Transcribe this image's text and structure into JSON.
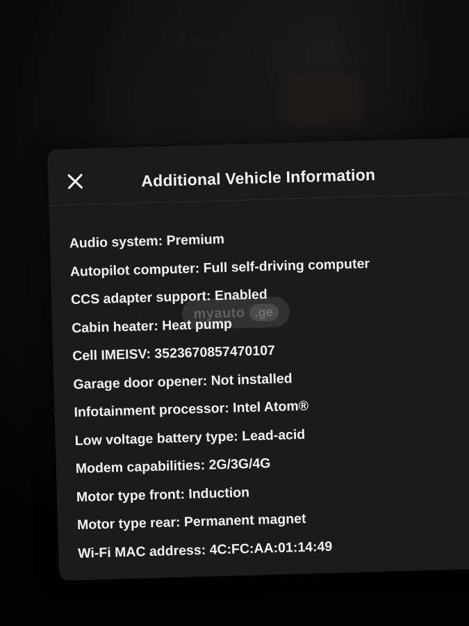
{
  "background": {
    "blurred_text": "Easy Entry"
  },
  "dialog": {
    "title": "Additional Vehicle Information",
    "close_icon": "close-icon",
    "rows": [
      {
        "label": "Audio system",
        "value": "Premium"
      },
      {
        "label": "Autopilot computer",
        "value": "Full self-driving computer"
      },
      {
        "label": "CCS adapter support",
        "value": "Enabled"
      },
      {
        "label": "Cabin heater",
        "value": "Heat pump"
      },
      {
        "label": "Cell IMEISV",
        "value": "3523670857470107"
      },
      {
        "label": "Garage door opener",
        "value": "Not installed"
      },
      {
        "label": "Infotainment processor",
        "value": "Intel Atom®"
      },
      {
        "label": "Low voltage battery type",
        "value": "Lead-acid"
      },
      {
        "label": "Modem capabilities",
        "value": "2G/3G/4G"
      },
      {
        "label": "Motor type front",
        "value": "Induction"
      },
      {
        "label": "Motor type rear",
        "value": "Permanent magnet"
      },
      {
        "label": "Wi-Fi MAC address",
        "value": "4C:FC:AA:01:14:49"
      }
    ]
  },
  "watermark": {
    "text": "myauto",
    "domain": ".ge"
  },
  "colors": {
    "panel_background": "#1b1b1c",
    "page_background": "#050505",
    "text": "#f1f1f1"
  }
}
